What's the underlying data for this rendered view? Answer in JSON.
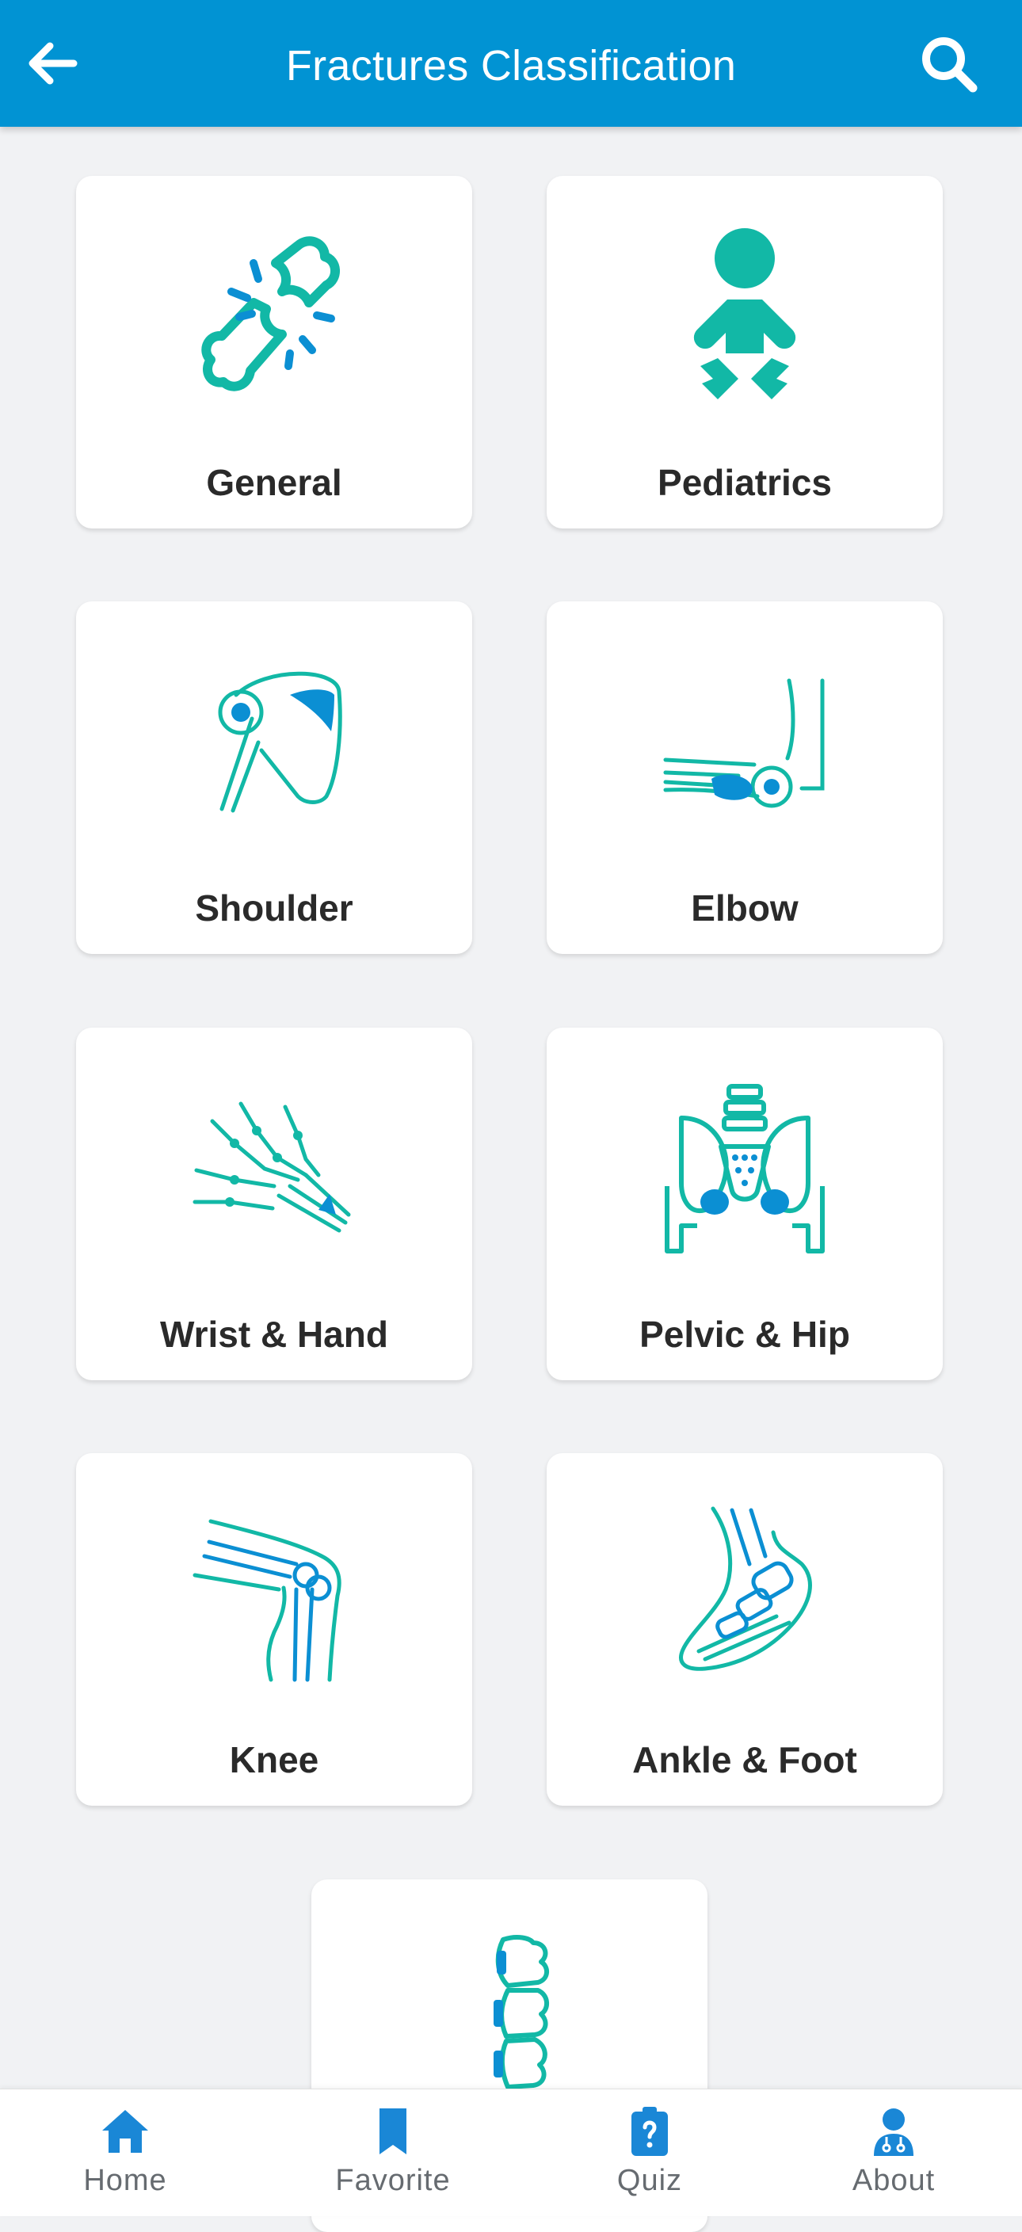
{
  "header": {
    "title": "Fractures Classification",
    "back_icon": "arrow-left-icon",
    "search_icon": "search-icon",
    "background": "#0193d3"
  },
  "categories": [
    {
      "label": "General",
      "icon": "broken-bone-icon"
    },
    {
      "label": "Pediatrics",
      "icon": "baby-icon"
    },
    {
      "label": "Shoulder",
      "icon": "shoulder-joint-icon"
    },
    {
      "label": "Elbow",
      "icon": "elbow-joint-icon"
    },
    {
      "label": "Wrist & Hand",
      "icon": "hand-bones-icon"
    },
    {
      "label": "Pelvic & Hip",
      "icon": "pelvis-icon"
    },
    {
      "label": "Knee",
      "icon": "knee-joint-icon"
    },
    {
      "label": "Ankle & Foot",
      "icon": "foot-bones-icon"
    },
    {
      "label": "",
      "icon": "spine-icon"
    }
  ],
  "bottom_nav": [
    {
      "label": "Home",
      "icon": "home-icon"
    },
    {
      "label": "Favorite",
      "icon": "bookmark-icon"
    },
    {
      "label": "Quiz",
      "icon": "quiz-icon"
    },
    {
      "label": "About",
      "icon": "doctor-icon"
    }
  ],
  "colors": {
    "accent_teal": "#12b8a6",
    "accent_blue": "#0b8fd3",
    "nav_blue": "#1a87d6",
    "background": "#f1f2f4"
  }
}
